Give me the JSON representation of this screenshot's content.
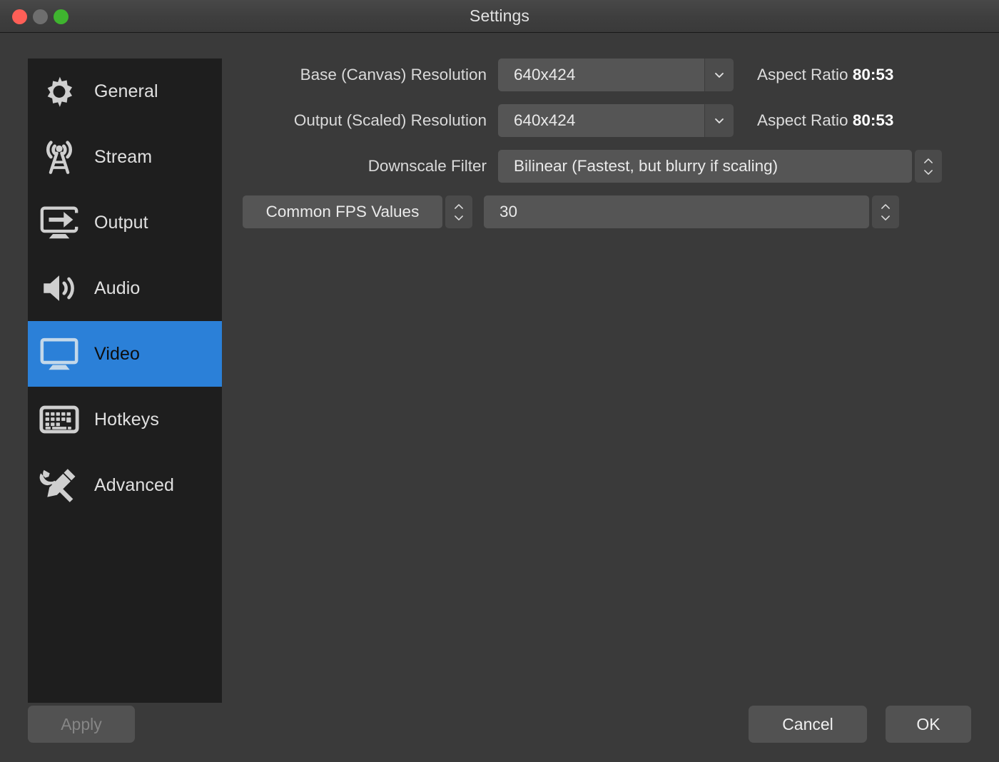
{
  "window": {
    "title": "Settings",
    "controls": [
      {
        "name": "close-button",
        "color": "#ff5f57"
      },
      {
        "name": "minimize-button",
        "color": "#6e6e6e"
      },
      {
        "name": "maximize-button",
        "color": "#3fb42f"
      }
    ]
  },
  "sidebar": {
    "selected": "Video",
    "accent_color": "#2b80d8",
    "items": [
      {
        "label": "General",
        "icon": "gear-icon"
      },
      {
        "label": "Stream",
        "icon": "broadcast-tower-icon"
      },
      {
        "label": "Output",
        "icon": "monitor-arrow-icon"
      },
      {
        "label": "Audio",
        "icon": "speaker-icon"
      },
      {
        "label": "Video",
        "icon": "monitor-icon"
      },
      {
        "label": "Hotkeys",
        "icon": "keyboard-icon"
      },
      {
        "label": "Advanced",
        "icon": "wrench-screwdriver-icon"
      }
    ]
  },
  "form": {
    "base_resolution": {
      "label": "Base (Canvas) Resolution",
      "value": "640x424",
      "aspect_prefix": "Aspect Ratio",
      "aspect_value": "80:53"
    },
    "output_resolution": {
      "label": "Output (Scaled) Resolution",
      "value": "640x424",
      "aspect_prefix": "Aspect Ratio",
      "aspect_value": "80:53"
    },
    "downscale_filter": {
      "label": "Downscale Filter",
      "value": "Bilinear (Fastest, but blurry if scaling)"
    },
    "fps": {
      "type_label": "Common FPS Values",
      "value": "30"
    }
  },
  "footer": {
    "apply_label": "Apply",
    "apply_disabled": true,
    "cancel_label": "Cancel",
    "ok_label": "OK"
  }
}
